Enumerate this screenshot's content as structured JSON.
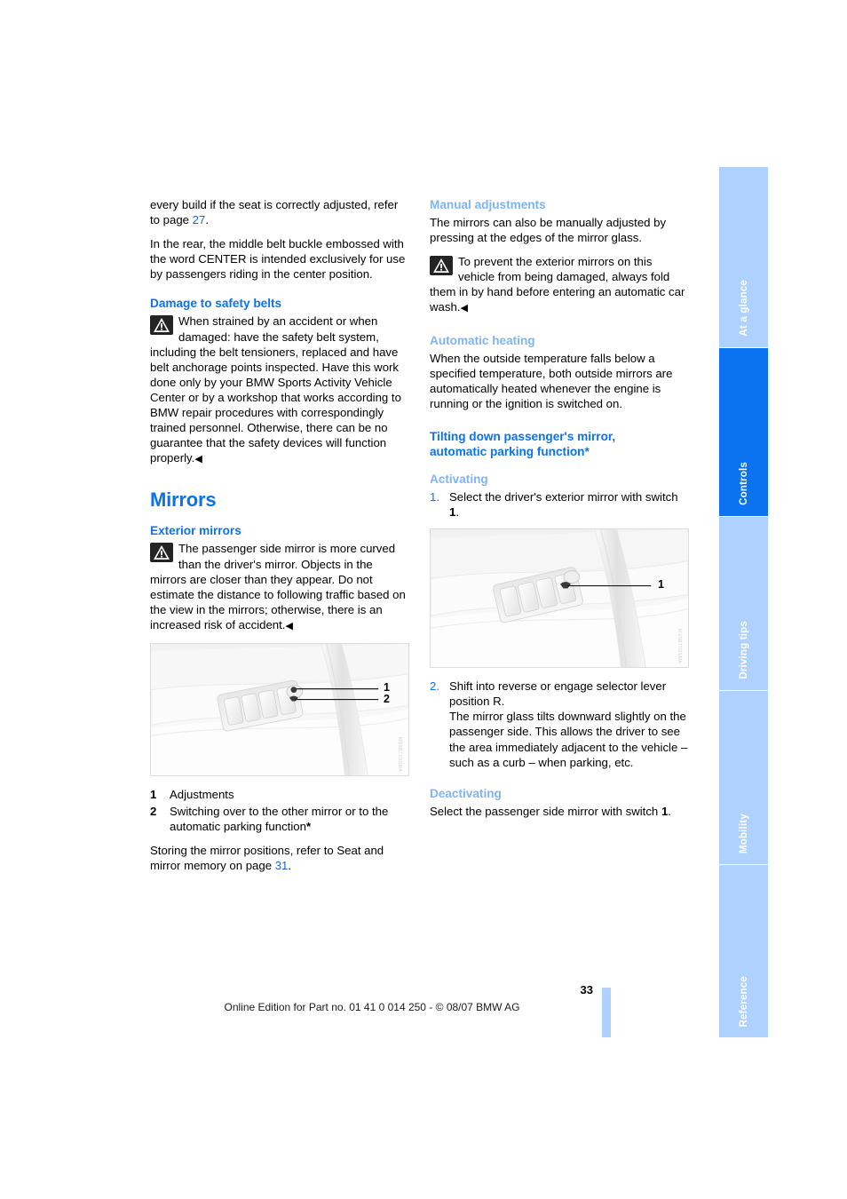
{
  "document": {
    "page_number": "33",
    "imprint": "Online Edition for Part no. 01 41 0 014 250 - © 08/07 BMW AG"
  },
  "sidebar": {
    "tabs": [
      {
        "label": "At a glance",
        "active": false
      },
      {
        "label": "Controls",
        "active": true
      },
      {
        "label": "Driving tips",
        "active": false
      },
      {
        "label": "Mobility",
        "active": false
      },
      {
        "label": "Reference",
        "active": false
      }
    ]
  },
  "left_column": {
    "para_continued": "every build if the seat is correctly adjusted, refer to page ",
    "para_continued_link": "27",
    "para_continued_end": ".",
    "para_center_belt": "In the rear, the middle belt buckle embossed with the word CENTER is intended exclusively for use by passengers riding in the center position.",
    "heading_damage": "Damage to safety belts",
    "warning_damage": "When strained by an accident or when damaged: have the safety belt system, including the belt tensioners, replaced and have belt anchorage points inspected. Have this work done only by your BMW Sports Activity Vehicle Center or by a workshop that works according to BMW repair procedures with correspondingly trained personnel. Otherwise, there can be no guarantee that the safety devices will function properly.",
    "chapter_title": "Mirrors",
    "heading_exterior": "Exterior mirrors",
    "warning_exterior": "The passenger side mirror is more curved than the driver's mirror. Objects in the mirrors are closer than they appear. Do not estimate the distance to following traffic based on the view in the mirrors; otherwise, there is an increased risk of accident.",
    "figure": {
      "code": "MV0B77OSMA",
      "callout_1": "1",
      "callout_2": "2"
    },
    "legend": [
      {
        "marker": "1",
        "text": "Adjustments",
        "star": ""
      },
      {
        "marker": "2",
        "text": "Switching over to the other mirror or to the automatic parking function",
        "star": "*"
      }
    ],
    "para_storing_pre": "Storing the mirror positions, refer to Seat and mirror memory on page ",
    "para_storing_link": "31",
    "para_storing_end": "."
  },
  "right_column": {
    "heading_manual": "Manual adjustments",
    "para_manual": "The mirrors can also be manually adjusted by pressing at the edges of the mirror glass.",
    "warning_manual": "To prevent the exterior mirrors on this vehicle from being damaged, always fold them in by hand before entering an automatic car wash.",
    "heading_auto_heating": "Automatic heating",
    "para_auto_heating": "When the outside temperature falls below a specified temperature, both outside mirrors are automatically heated whenever the engine is running or the ignition is switched on.",
    "heading_tilting_line1": "Tilting down passenger's mirror,",
    "heading_tilting_line2": "automatic parking function*",
    "heading_activating": "Activating",
    "step1_marker": "1.",
    "step1_text_pre": "Select the driver's exterior mirror with switch ",
    "step1_bold": "1",
    "step1_text_end": ".",
    "figure": {
      "code": "MV0B77OSMA",
      "callout_1": "1"
    },
    "step2_marker": "2.",
    "step2_text": "Shift into reverse or engage selector lever position R.",
    "step2_text_cont": "The mirror glass tilts downward slightly on the passenger side. This allows the driver to see the area immediately adjacent to the vehicle – such as a curb – when parking, etc.",
    "heading_deactivating": "Deactivating",
    "para_deactivating_pre": "Select the passenger side mirror with switch ",
    "para_deactivating_bold": "1",
    "para_deactivating_end": "."
  },
  "colors": {
    "accent_blue": "#0b72f0",
    "light_blue": "#7fb4f2",
    "tab_blue": "#aed2fd",
    "link_blue": "#2060e0"
  },
  "icons": {
    "warning": "warning-triangle-icon",
    "end_mark": "◀"
  }
}
